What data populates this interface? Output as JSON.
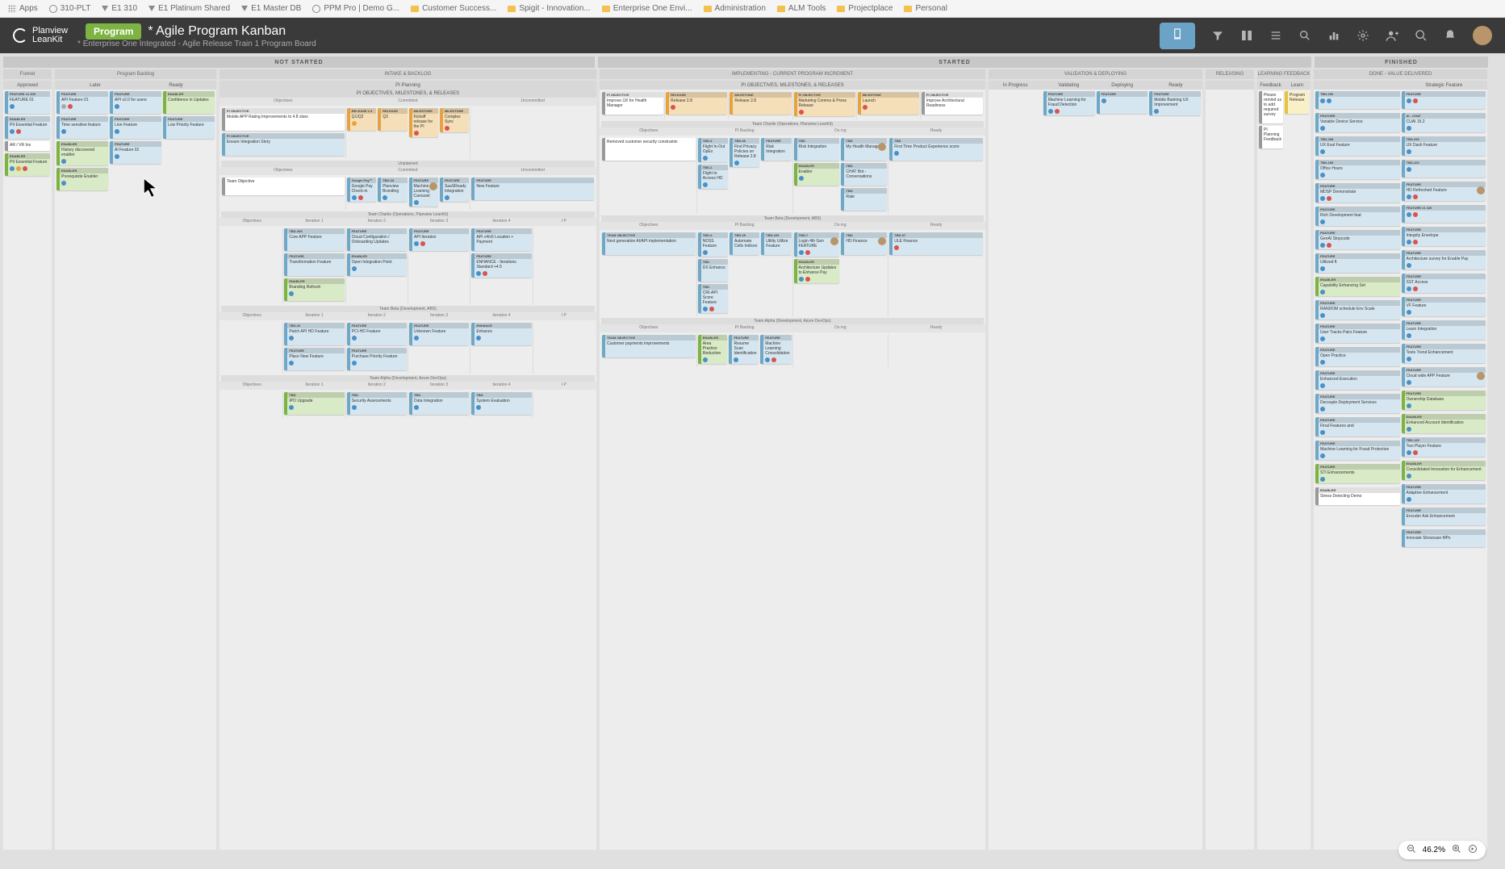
{
  "browser": {
    "tabs": [
      {
        "icon": "apps",
        "label": "Apps"
      },
      {
        "icon": "globe",
        "label": "310-PLT"
      },
      {
        "icon": "pv",
        "label": "E1 310"
      },
      {
        "icon": "pv",
        "label": "E1 Platinum Shared"
      },
      {
        "icon": "pv",
        "label": "E1 Master DB"
      },
      {
        "icon": "globe",
        "label": "PPM Pro | Demo G..."
      },
      {
        "icon": "folder",
        "label": "Customer Success..."
      },
      {
        "icon": "folder",
        "label": "Spigit - Innovation..."
      },
      {
        "icon": "folder",
        "label": "Enterprise One Envi..."
      },
      {
        "icon": "folder",
        "label": "Administration"
      },
      {
        "icon": "folder",
        "label": "ALM Tools"
      },
      {
        "icon": "folder",
        "label": "Projectplace"
      },
      {
        "icon": "folder",
        "label": "Personal"
      }
    ]
  },
  "header": {
    "logo_top": "Planview",
    "logo_bottom": "LeanKit",
    "badge": "Program",
    "title": "* Agile Program Kanban",
    "subtitle": "* Enterprise One Integrated - Agile Release Train 1 Program Board"
  },
  "phases": {
    "not_started": "NOT STARTED",
    "started": "STARTED",
    "finished": "FINISHED"
  },
  "subphases": {
    "intake": "INTAKE & BACKLOG",
    "implementing": "IMPLEMENTING - CURRENT PROGRAM INCREMENT",
    "validation": "VALIDATION & DEPLOYING",
    "releasing": "RELEASING",
    "learning": "LEARNING FEEDBACK",
    "done": "DONE - VALUE DELIVERED"
  },
  "columns": {
    "funnel": "Funnel",
    "approved": "Approved",
    "program_backlog": "Program Backlog",
    "later": "Later",
    "ready": "Ready",
    "pi_planning": "PI Planning",
    "objectives_milestones": "PI OBJECTIVES, MILESTONES, & RELEASES",
    "objectives": "Objectives",
    "committed": "Committed",
    "uncommitted": "Uncommitted",
    "in_progress": "In Progress",
    "validating": "Validating",
    "deploying": "Deploying",
    "feedback": "Feedback",
    "learn": "Learn",
    "ready2": "Ready",
    "pi_backlog": "PI Backlog",
    "doing": "Do ing",
    "iteration1": "Iteration 1",
    "iteration2": "Iteration 2",
    "iteration3": "Iteration 3",
    "iteration4": "Iteration 4",
    "ip": "I P",
    "strategic": "Strategic Feature"
  },
  "teams": {
    "charlie": "Team Charlie (Operations, Planview LeanKit)",
    "beta": "Team Beta (Development, ABS)",
    "alpha": "Team Alpha (Development, Azure DevOps)",
    "charlie_ops": "Team Charlie (Operations, Planview LeanKit)",
    "beta_dev": "Team Beta (Development, ABS)",
    "alpha_dev": "Team Alpha (Development, Azure DevOps)",
    "unplanned": "Unplanned"
  },
  "cards": {
    "funnel1": {
      "h": "FEATURE #1 305",
      "t": "FEATURE 01"
    },
    "funnel2": {
      "h": "ENABLER",
      "t": "PII Essential Feature"
    },
    "funnel_ar": {
      "h": "",
      "t": "AR / VR Ins"
    },
    "backlog1": {
      "h": "FEATURE",
      "t": "API Feature 01"
    },
    "backlog2": {
      "h": "FEATURE",
      "t": "Time sensitive feature"
    },
    "backlog3": {
      "h": "ENABLER",
      "t": "History discovered enabler"
    },
    "backlog4": {
      "h": "ENABLER",
      "t": "Prerequisite Enabler"
    },
    "later1": {
      "h": "FEATURE",
      "t": "API v2.0 for users"
    },
    "later2": {
      "h": "FEATURE",
      "t": "Lion Feature"
    },
    "later3": {
      "h": "FEATURE",
      "t": "AI Feature 02"
    },
    "ready1": {
      "h": "ENABLER",
      "t": "Confidence in Updates"
    },
    "ready2": {
      "h": "FEATURE",
      "t": "Low Priority Feature"
    },
    "obj1": {
      "h": "PI OBJECTIVE",
      "t": "Mobile APP Rating Improvements to 4.8 stars"
    },
    "obj2": {
      "h": "PI OBJECTIVE",
      "t": "Ensure Integration Story"
    },
    "rel1": {
      "h": "RELEASE 2.3",
      "t": "Q1/Q2"
    },
    "rel2": {
      "h": "RELEASE",
      "t": "Q3"
    },
    "ms1": {
      "h": "MILESTONE",
      "t": "Kickoff release for the PI"
    },
    "ms2": {
      "h": "MILESTONE",
      "t": "Complex Sync"
    },
    "team_obj": {
      "h": "",
      "t": "Team Objective"
    },
    "google_pay": {
      "h": "Google Pay™",
      "t": "Google Pay Check-in"
    },
    "tbd3": {
      "h": "TBD-03",
      "t": "Planview Branding"
    },
    "tbd12": {
      "h": "FEATURE",
      "t": "Machine Learning Carousel"
    },
    "saasready": {
      "h": "FEATURE",
      "t": "SaaSReady Integration"
    },
    "new_feat": {
      "h": "FEATURE",
      "t": "New Feature"
    },
    "hd_feat": {
      "h": "TBD-405",
      "t": "Core APP Feature"
    },
    "trans_feat": {
      "h": "FEATURE",
      "t": "Transformation Feature"
    },
    "cloud_cfg": {
      "h": "FEATURE",
      "t": "Cloud Configuration / Onboarding Updates"
    },
    "brand_ref": {
      "h": "ENABLER",
      "t": "Branding Refresh"
    },
    "opt_integ": {
      "h": "ENABLER",
      "t": "Open Integration Point"
    },
    "api_iter": {
      "h": "FEATURE",
      "t": "API Iteration"
    },
    "api_v4": {
      "h": "FEATURE",
      "t": "API v4/v5 Location + Payment"
    },
    "enhance": {
      "h": "FEATURE",
      "t": "ENHANCE - Iterations Standard +4.5"
    },
    "i1_patch": {
      "h": "TBD-02",
      "t": "Patch API HD Feature"
    },
    "i3_enh": {
      "h": "ENHANCE",
      "t": "Enhance"
    },
    "i2_pnf": {
      "h": "FEATURE",
      "t": "Place New Feature"
    },
    "i2_ppf": {
      "h": "FEATURE",
      "t": "Purchase Priority Feature"
    },
    "sec_assess": {
      "h": "TBD",
      "t": "Security Assessments"
    },
    "data_integ": {
      "h": "TBD",
      "t": "Data Integration"
    },
    "sys_eval": {
      "h": "TBD",
      "t": "System Evaluation"
    },
    "ipo": {
      "h": "TBD",
      "t": "IPO Upgrade"
    },
    "impl_obj1": {
      "h": "PI OBJECTIVE",
      "t": "Improve UX for Health Manager"
    },
    "impl_rel": {
      "h": "RELEASE",
      "t": "Release 2.8"
    },
    "impl_ms": {
      "h": "MILESTONE",
      "t": "Release 2.8"
    },
    "impl_obj2": {
      "h": "PI OBJECTIVE",
      "t": "Marketing Comms & Press Release"
    },
    "impl_obj3": {
      "h": "PI OBJECTIVE",
      "t": "Improve Architectural Readiness"
    },
    "cc_obj": {
      "h": "",
      "t": "Removed customer security constraints"
    },
    "cc_flight": {
      "h": "TBD-3",
      "t": "Flight In-Out OpEx"
    },
    "cc_priv": {
      "h": "TBD-06",
      "t": "First Privacy Policies on Release 2.8"
    },
    "cc_risk": {
      "h": "FEATURE",
      "t": "Risk Integration"
    },
    "cc_health": {
      "h": "TBD",
      "t": "My Health Manager"
    },
    "cc_chatbot": {
      "h": "TBD",
      "t": "CHAT Bot - Conversations"
    },
    "cc_fp": {
      "h": "TBD",
      "t": "First Time Product Experience score"
    },
    "cc_flight2": {
      "h": "TBD-2",
      "t": "Flight to Access HD"
    },
    "cc_risk3": {
      "h": "TBD-3",
      "t": "Risk Integration"
    },
    "cc_rate": {
      "h": "TBD",
      "t": "Rate"
    },
    "beta_obj": {
      "h": "TEAM OBJECTIVE",
      "t": "Next generation AI/API implementation"
    },
    "beta_ndss": {
      "h": "TBD-4",
      "t": "NDSS Feature"
    },
    "beta_dx": {
      "h": "TBD",
      "t": "DX Enhance"
    },
    "beta_cri": {
      "h": "TBD",
      "t": "CRI-API Score Feature"
    },
    "beta_auto": {
      "h": "TBD-35",
      "t": "Automate Cells Indices"
    },
    "beta_util": {
      "h": "TBD-100",
      "t": "Utility Utilize Feature"
    },
    "beta_login": {
      "h": "TBD-7",
      "t": "Login 4th Gen FEATURE"
    },
    "beta_arch": {
      "h": "ENABLER",
      "t": "Architecture Updates to Enhance Pay"
    },
    "beta_hd": {
      "h": "TBD",
      "t": "HD Finance"
    },
    "beta_ule": {
      "h": "TBD-07",
      "t": "ULE Finance"
    },
    "alpha_obj": {
      "h": "TEAM OBJECTIVE",
      "t": "Customer payments improvements"
    },
    "alpha_pp": {
      "h": "ENABLER",
      "t": "Area Practice Reduction"
    },
    "alpha_res": {
      "h": "FEATURE",
      "t": "Resume Scan Identification"
    },
    "alpha_ml": {
      "h": "FEATURE",
      "t": "Machine Learning Consolidation"
    },
    "valid1": {
      "h": "FEATURE",
      "t": "Machine Learning for Fraud Detection"
    },
    "valid2": {
      "h": "FEATURE",
      "t": ""
    },
    "deploy1": {
      "h": "FEATURE",
      "t": "Mobile Banking UX Improvement"
    },
    "feedback1": {
      "h": "",
      "t": "Please remind us to add required survey"
    },
    "feedback2": {
      "h": "",
      "t": "PI Planning Feedback"
    },
    "learn1": {
      "h": "",
      "t": "Program Release"
    },
    "done_header": {
      "h": "STRATEGIC",
      "t": "Strategic Feature"
    },
    "d1": {
      "h": "FEATURE",
      "t": "Variable Device Service"
    },
    "d2": {
      "h": "TBD-296",
      "t": "UX Dash Feature"
    },
    "d3": {
      "h": "TBD-298",
      "t": "UX Eval Feature"
    },
    "d4": {
      "h": "TBD-299",
      "t": "Office Hours"
    },
    "d5": {
      "h": "FEATURE",
      "t": "MDSP Demonstrate"
    },
    "d6": {
      "h": "FEATURE",
      "t": "Rich Development feat"
    },
    "d7": {
      "h": "FEATURE",
      "t": "GenAI Stopcode"
    },
    "d8": {
      "h": "FEATURE",
      "t": "Utilized ft"
    },
    "d9": {
      "h": "ENABLER",
      "t": "Capability Enhancing Set"
    },
    "d10": {
      "h": "FEATURE",
      "t": "RANDOM schedule Env Scale"
    },
    "d11": {
      "h": "FEATURE",
      "t": "User Tracks Pairs Feature"
    },
    "d12": {
      "h": "FEATURE",
      "t": "Open Practice"
    },
    "d13": {
      "h": "FEATURE",
      "t": "Enhanced Execution"
    },
    "d14": {
      "h": "FEATURE",
      "t": "Decouple Deployment Services"
    },
    "d15": {
      "h": "FEATURE",
      "t": "Final Features and"
    },
    "d16": {
      "h": "FEATURE",
      "t": "Machine Learning for Fraud Protection"
    },
    "d17": {
      "h": "FEATURE",
      "t": "STI Enhancements"
    },
    "d18": {
      "h": "ENABLER",
      "t": "Stress Detecting Demo"
    },
    "d19": {
      "h": "AI - CHAT",
      "t": "CUAI 15.2"
    },
    "d20": {
      "h": "FEATURE",
      "t": "HD Refreshed Feature"
    },
    "d21": {
      "h": "FEATURE #1 340",
      "t": ""
    },
    "d22": {
      "h": "FEATURE",
      "t": "Integrity Envelope"
    },
    "d23": {
      "h": "FEATURE",
      "t": "Architecture survey for Enable Pay"
    },
    "d24": {
      "h": "FEATURE",
      "t": "SST Access"
    },
    "d25": {
      "h": "FEATURE",
      "t": "VF Feature"
    },
    "d26": {
      "h": "FEATURE",
      "t": "Learn Integration"
    },
    "d27": {
      "h": "FEATURE",
      "t": "Tests Trend Enhancement"
    },
    "d28": {
      "h": "FEATURE",
      "t": "Cloud wide APP Feature"
    },
    "d29": {
      "h": "FEATURE",
      "t": "Ownership Database"
    },
    "d30": {
      "h": "ENABLER",
      "t": "Enhanced Account Identification"
    },
    "d31": {
      "h": "TBD-125",
      "t": "Two Player Feature"
    },
    "d32": {
      "h": "ENABLER",
      "t": "Consolidated Innovation for Enhancement"
    },
    "d33": {
      "h": "FEATURE",
      "t": "Adaptive Enhancement"
    },
    "d34": {
      "h": "FEATURE",
      "t": "Encoder Ask Enhancement"
    },
    "d35": {
      "h": "FEATURE",
      "t": "Innovate Showcase MPs"
    }
  },
  "zoom": {
    "level": "46.2%"
  }
}
